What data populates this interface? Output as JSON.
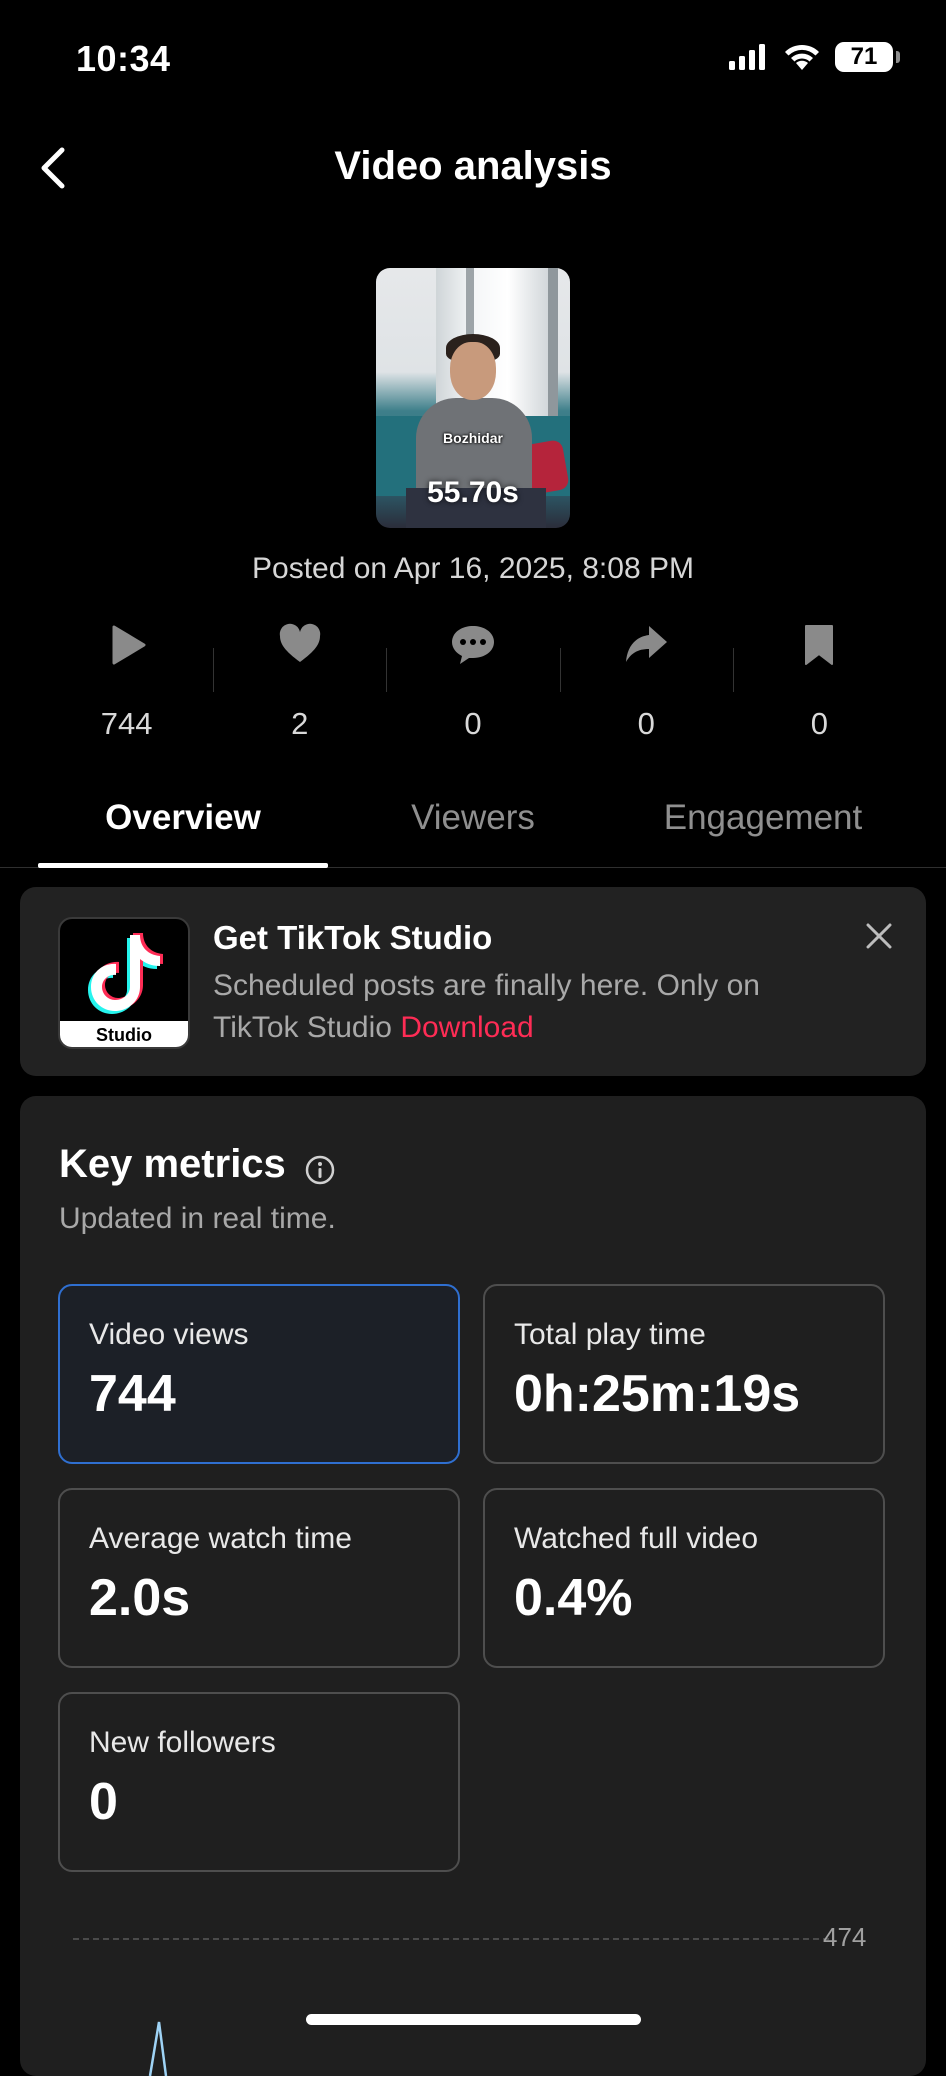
{
  "status_bar": {
    "time": "10:34",
    "battery": "71",
    "icons": [
      "signal-icon",
      "wifi-icon",
      "battery-icon"
    ]
  },
  "header": {
    "title": "Video analysis",
    "back_icon": "chevron-left-icon"
  },
  "video": {
    "overlay_name": "Bozhidar",
    "duration": "55.70s",
    "posted": "Posted on Apr 16, 2025, 8:08 PM"
  },
  "stats": [
    {
      "icon": "play-icon",
      "value": "744"
    },
    {
      "icon": "heart-icon",
      "value": "2"
    },
    {
      "icon": "comment-icon",
      "value": "0"
    },
    {
      "icon": "share-icon",
      "value": "0"
    },
    {
      "icon": "bookmark-icon",
      "value": "0"
    }
  ],
  "tabs": [
    {
      "label": "Overview",
      "active": true
    },
    {
      "label": "Viewers",
      "active": false
    },
    {
      "label": "Engagement",
      "active": false
    }
  ],
  "banner": {
    "logo_label": "Studio",
    "title": "Get TikTok Studio",
    "text": "Scheduled posts are finally here. Only on TikTok Studio",
    "link": "Download",
    "link_color": "#fe2c55"
  },
  "key_metrics": {
    "title": "Key metrics",
    "subtitle": "Updated in real time.",
    "cards": [
      {
        "label": "Video views",
        "value": "744",
        "selected": true
      },
      {
        "label": "Total play time",
        "value": "0h:25m:19s",
        "selected": false
      },
      {
        "label": "Average watch time",
        "value": "2.0s",
        "selected": false
      },
      {
        "label": "Watched full video",
        "value": "0.4%",
        "selected": false
      },
      {
        "label": "New followers",
        "value": "0",
        "selected": false
      }
    ],
    "chart_max_label": "474"
  },
  "colors": {
    "background": "#000000",
    "panel": "#1f1f1f",
    "selected_border": "#2f6fd0",
    "chart_line": "#9fd3f5"
  }
}
